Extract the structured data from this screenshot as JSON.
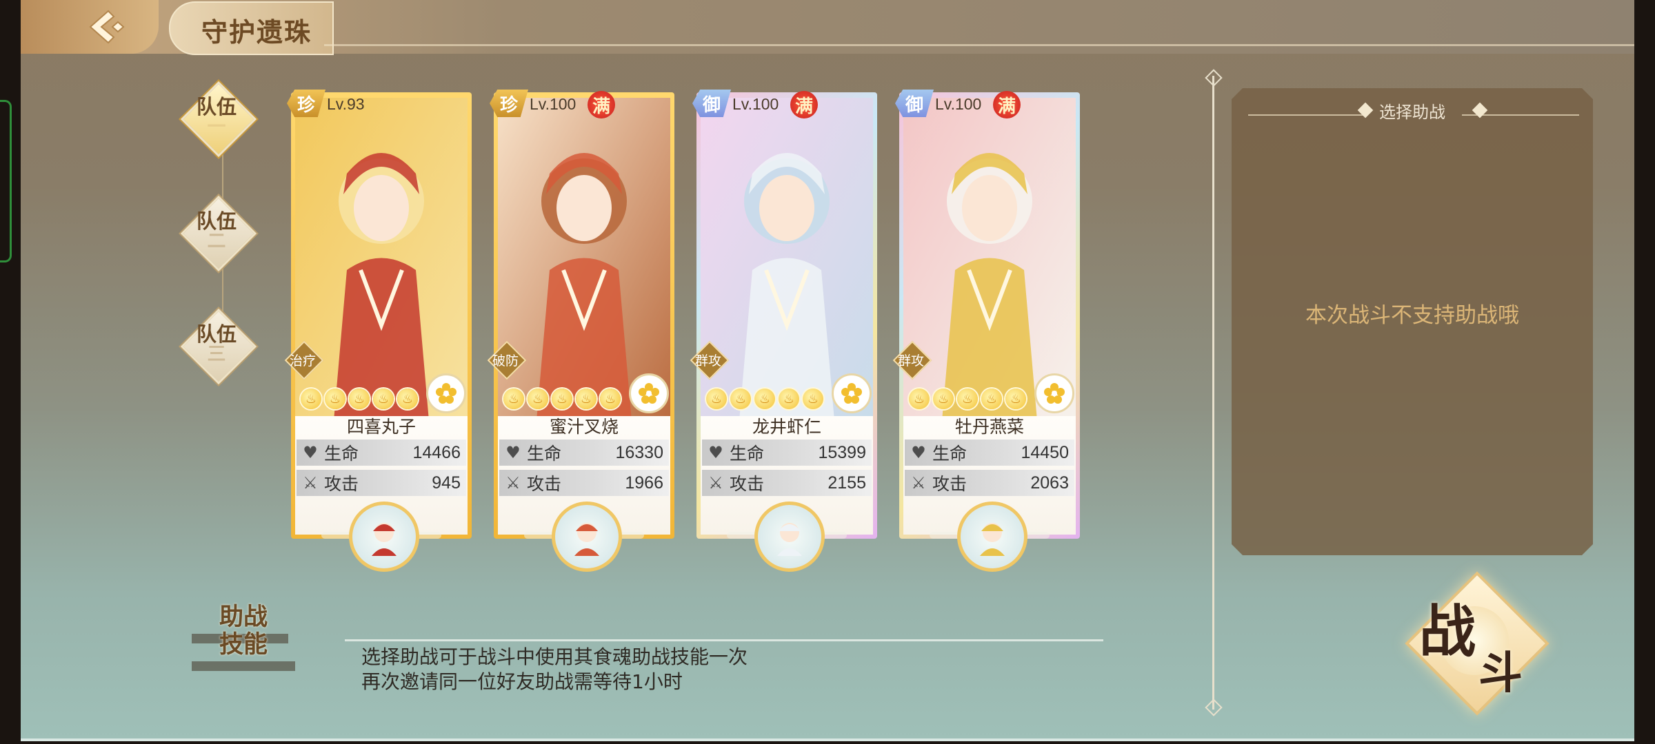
{
  "header": {
    "title": "守护遗珠"
  },
  "teams": [
    {
      "label": "队伍",
      "num": "一",
      "active": true
    },
    {
      "label": "队伍",
      "num": "二",
      "active": false
    },
    {
      "label": "队伍",
      "num": "三",
      "active": false
    }
  ],
  "cards": [
    {
      "grade": "珍",
      "grade_type": "rare",
      "level": "Lv.93",
      "max": "",
      "role": "治疗",
      "name": "四喜丸子",
      "hp_label": "生命",
      "hp": "14466",
      "atk_label": "攻击",
      "atk": "945",
      "frame": "gold",
      "art_colors": [
        "#f2c85c",
        "#c4392f",
        "#f7e2a1"
      ],
      "stars": 5
    },
    {
      "grade": "珍",
      "grade_type": "rare",
      "level": "Lv.100",
      "max": "满",
      "role": "破防",
      "name": "蜜汁叉烧",
      "hp_label": "生命",
      "hp": "16330",
      "atk_label": "攻击",
      "atk": "1966",
      "frame": "gold",
      "art_colors": [
        "#f7e1c8",
        "#d65a3a",
        "#b96a3e"
      ],
      "stars": 5
    },
    {
      "grade": "御",
      "grade_type": "royal",
      "level": "Lv.100",
      "max": "满",
      "role": "群攻",
      "name": "龙井虾仁",
      "hp_label": "生命",
      "hp": "15399",
      "atk_label": "攻击",
      "atk": "2155",
      "frame": "rainbow",
      "art_colors": [
        "#f3d6ef",
        "#eef3f7",
        "#c7dcea"
      ],
      "stars": 5
    },
    {
      "grade": "御",
      "grade_type": "royal",
      "level": "Lv.100",
      "max": "满",
      "role": "群攻",
      "name": "牡丹燕菜",
      "hp_label": "生命",
      "hp": "14450",
      "atk_label": "攻击",
      "atk": "2063",
      "frame": "rainbow",
      "art_colors": [
        "#f3c6c6",
        "#e8c24a",
        "#f6f2ec"
      ],
      "stars": 5
    }
  ],
  "support": {
    "title": "选择助战",
    "message": "本次战斗不支持助战哦"
  },
  "skill": {
    "badge_line1": "助战",
    "badge_line2": "技能",
    "desc_line1": "选择助战可于战斗中使用其食魂助战技能一次",
    "desc_line2": "再次邀请同一位好友助战需等待1小时"
  },
  "battle": {
    "label1": "战",
    "label2": "斗"
  },
  "colors": {
    "accent_gold": "#f2b637",
    "text_brown": "#6b4b27",
    "panel_bg": "#776247",
    "panel_text": "#dcb677"
  }
}
